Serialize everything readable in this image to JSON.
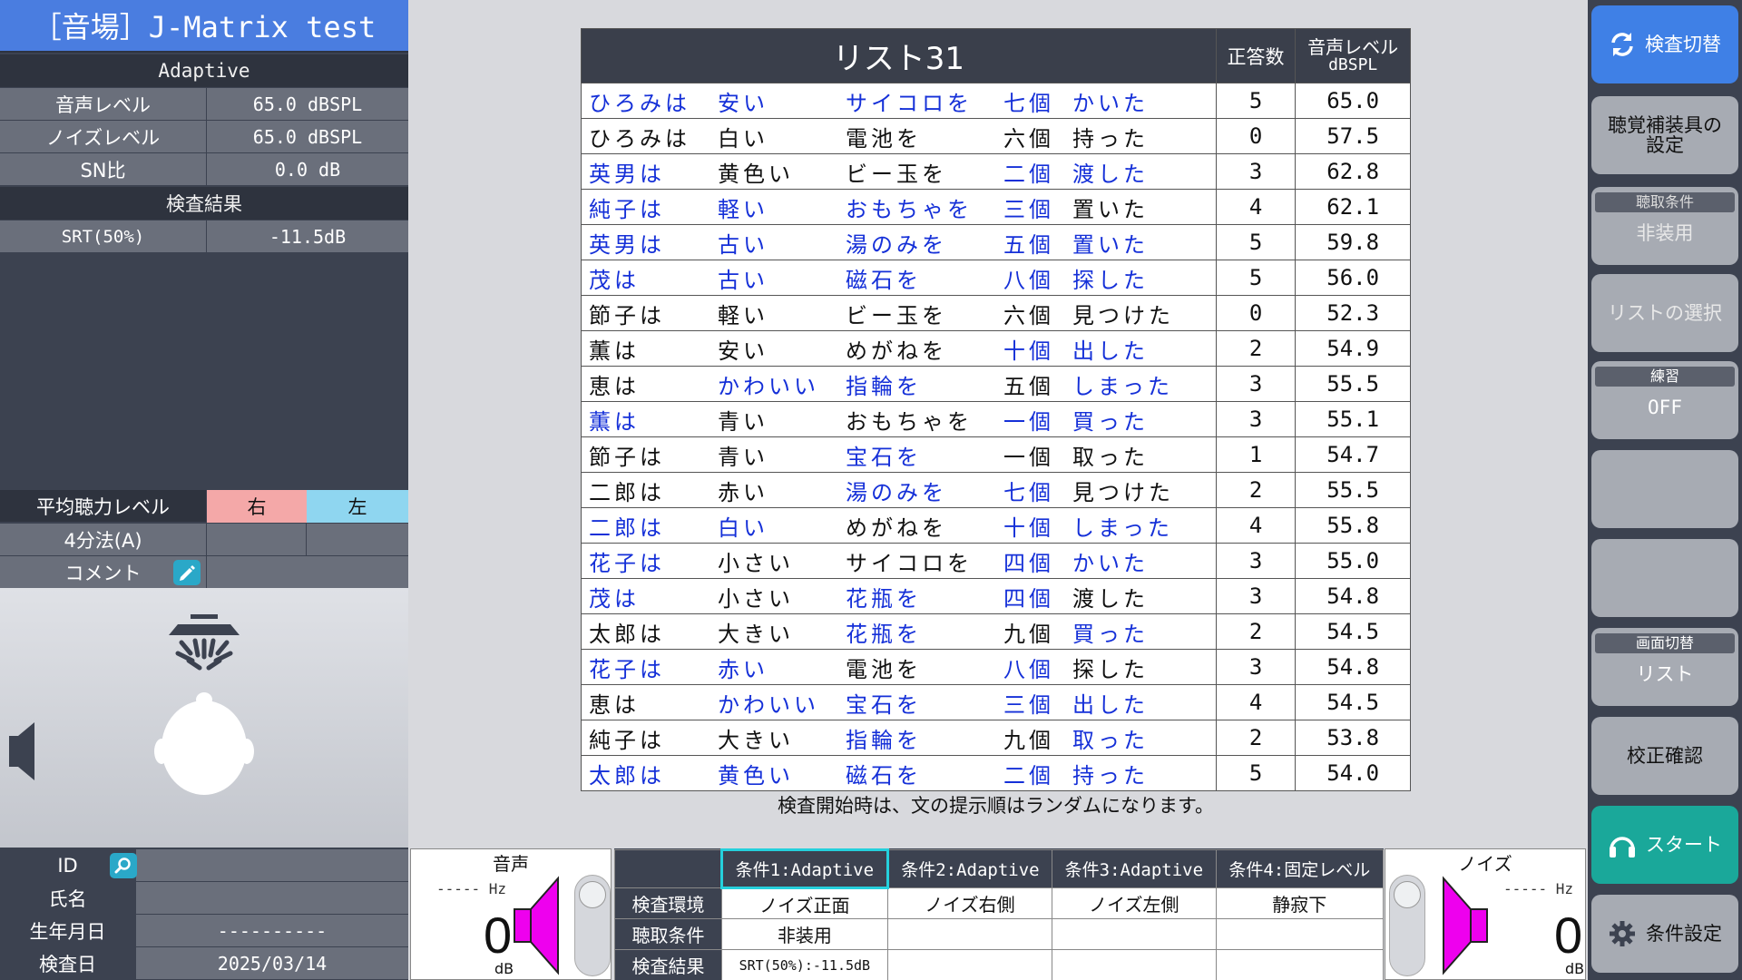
{
  "app_title": "［音場］J-Matrix test",
  "mode_header": "Adaptive",
  "params": [
    {
      "label": "音声レベル",
      "value": "65.0 dBSPL"
    },
    {
      "label": "ノイズレベル",
      "value": "65.0 dBSPL"
    },
    {
      "label": "SN比",
      "value": "0.0 dB"
    }
  ],
  "results_header": "検査結果",
  "result_row": {
    "label": "SRT(50%)",
    "value": "-11.5dB"
  },
  "hearing": {
    "label": "平均聴力レベル",
    "right": "右",
    "left": "左",
    "method": "4分法(A)",
    "comment": "コメント"
  },
  "patient": [
    {
      "label": "ID",
      "value": ""
    },
    {
      "label": "氏名",
      "value": ""
    },
    {
      "label": "生年月日",
      "value": "----------"
    },
    {
      "label": "検査日",
      "value": "2025/03/14"
    }
  ],
  "list": {
    "title": "リスト31",
    "col_correct": "正答数",
    "col_level_1": "音声レベル",
    "col_level_2": "dBSPL",
    "rows": [
      {
        "w": [
          "ひろみは",
          "安い",
          "サイコロを",
          "七個",
          "かいた"
        ],
        "c": [
          1,
          1,
          1,
          1,
          1
        ],
        "correct": "5",
        "level": "65.0"
      },
      {
        "w": [
          "ひろみは",
          "白い",
          "電池を",
          "六個",
          "持った"
        ],
        "c": [
          0,
          0,
          0,
          0,
          0
        ],
        "correct": "0",
        "level": "57.5"
      },
      {
        "w": [
          "英男は",
          "黄色い",
          "ビー玉を",
          "二個",
          "渡した"
        ],
        "c": [
          1,
          0,
          0,
          1,
          1
        ],
        "correct": "3",
        "level": "62.8"
      },
      {
        "w": [
          "純子は",
          "軽い",
          "おもちゃを",
          "三個",
          "置いた"
        ],
        "c": [
          1,
          1,
          1,
          1,
          0
        ],
        "correct": "4",
        "level": "62.1"
      },
      {
        "w": [
          "英男は",
          "古い",
          "湯のみを",
          "五個",
          "置いた"
        ],
        "c": [
          1,
          1,
          1,
          1,
          1
        ],
        "correct": "5",
        "level": "59.8"
      },
      {
        "w": [
          "茂は",
          "古い",
          "磁石を",
          "八個",
          "探した"
        ],
        "c": [
          1,
          1,
          1,
          1,
          1
        ],
        "correct": "5",
        "level": "56.0"
      },
      {
        "w": [
          "節子は",
          "軽い",
          "ビー玉を",
          "六個",
          "見つけた"
        ],
        "c": [
          0,
          0,
          0,
          0,
          0
        ],
        "correct": "0",
        "level": "52.3"
      },
      {
        "w": [
          "薫は",
          "安い",
          "めがねを",
          "十個",
          "出した"
        ],
        "c": [
          0,
          0,
          0,
          1,
          1
        ],
        "correct": "2",
        "level": "54.9"
      },
      {
        "w": [
          "恵は",
          "かわいい",
          "指輪を",
          "五個",
          "しまった"
        ],
        "c": [
          0,
          1,
          1,
          0,
          1
        ],
        "correct": "3",
        "level": "55.5"
      },
      {
        "w": [
          "薫は",
          "青い",
          "おもちゃを",
          "一個",
          "買った"
        ],
        "c": [
          1,
          0,
          0,
          1,
          1
        ],
        "correct": "3",
        "level": "55.1"
      },
      {
        "w": [
          "節子は",
          "青い",
          "宝石を",
          "一個",
          "取った"
        ],
        "c": [
          0,
          0,
          1,
          0,
          0
        ],
        "correct": "1",
        "level": "54.7"
      },
      {
        "w": [
          "二郎は",
          "赤い",
          "湯のみを",
          "七個",
          "見つけた"
        ],
        "c": [
          0,
          0,
          1,
          1,
          0
        ],
        "correct": "2",
        "level": "55.5"
      },
      {
        "w": [
          "二郎は",
          "白い",
          "めがねを",
          "十個",
          "しまった"
        ],
        "c": [
          1,
          1,
          0,
          1,
          1
        ],
        "correct": "4",
        "level": "55.8"
      },
      {
        "w": [
          "花子は",
          "小さい",
          "サイコロを",
          "四個",
          "かいた"
        ],
        "c": [
          1,
          0,
          0,
          1,
          1
        ],
        "correct": "3",
        "level": "55.0"
      },
      {
        "w": [
          "茂は",
          "小さい",
          "花瓶を",
          "四個",
          "渡した"
        ],
        "c": [
          1,
          0,
          1,
          1,
          0
        ],
        "correct": "3",
        "level": "54.8"
      },
      {
        "w": [
          "太郎は",
          "大きい",
          "花瓶を",
          "九個",
          "買った"
        ],
        "c": [
          0,
          0,
          1,
          0,
          1
        ],
        "correct": "2",
        "level": "54.5"
      },
      {
        "w": [
          "花子は",
          "赤い",
          "電池を",
          "八個",
          "探した"
        ],
        "c": [
          1,
          1,
          0,
          1,
          0
        ],
        "correct": "3",
        "level": "54.8"
      },
      {
        "w": [
          "恵は",
          "かわいい",
          "宝石を",
          "三個",
          "出した"
        ],
        "c": [
          0,
          1,
          1,
          1,
          1
        ],
        "correct": "4",
        "level": "54.5"
      },
      {
        "w": [
          "純子は",
          "大きい",
          "指輪を",
          "九個",
          "取った"
        ],
        "c": [
          0,
          0,
          1,
          0,
          1
        ],
        "correct": "2",
        "level": "53.8"
      },
      {
        "w": [
          "太郎は",
          "黄色い",
          "磁石を",
          "二個",
          "持った"
        ],
        "c": [
          1,
          1,
          1,
          1,
          1
        ],
        "correct": "5",
        "level": "54.0"
      }
    ]
  },
  "note": "検査開始時は、文の提示順はランダムになります。",
  "voice_meter": {
    "title": "音声",
    "hz": "----- Hz",
    "value": "0",
    "unit": "dB"
  },
  "noise_meter": {
    "title": "ノイズ",
    "hz": "----- Hz",
    "value": "0",
    "unit": "dB"
  },
  "conditions": {
    "tabs": [
      "条件1:Adaptive",
      "条件2:Adaptive",
      "条件3:Adaptive",
      "条件4:固定レベル"
    ],
    "rows": [
      {
        "label": "検査環境",
        "values": [
          "ノイズ正面",
          "ノイズ右側",
          "ノイズ左側",
          "静寂下"
        ]
      },
      {
        "label": "聴取条件",
        "values": [
          "非装用",
          "",
          "",
          ""
        ]
      },
      {
        "label": "検査結果",
        "values": [
          "SRT(50%):-11.5dB",
          "",
          "",
          ""
        ]
      }
    ]
  },
  "right_panel": {
    "switch_test": "検査切替",
    "hearing_aid_1": "聴覚補装具の",
    "hearing_aid_2": "設定",
    "listen_caption": "聴取条件",
    "listen_value": "非装用",
    "list_select": "リストの選択",
    "practice_caption": "練習",
    "practice_value": "OFF",
    "screen_caption": "画面切替",
    "screen_value": "リスト",
    "calibration": "校正確認",
    "start": "スタート",
    "settings": "条件設定"
  },
  "colors": {
    "accent": "#3f80e6",
    "correct_word": "#1530d8",
    "start": "#1aa89a",
    "speaker": "#ee00ee",
    "tab_active": "#25d0dc"
  }
}
